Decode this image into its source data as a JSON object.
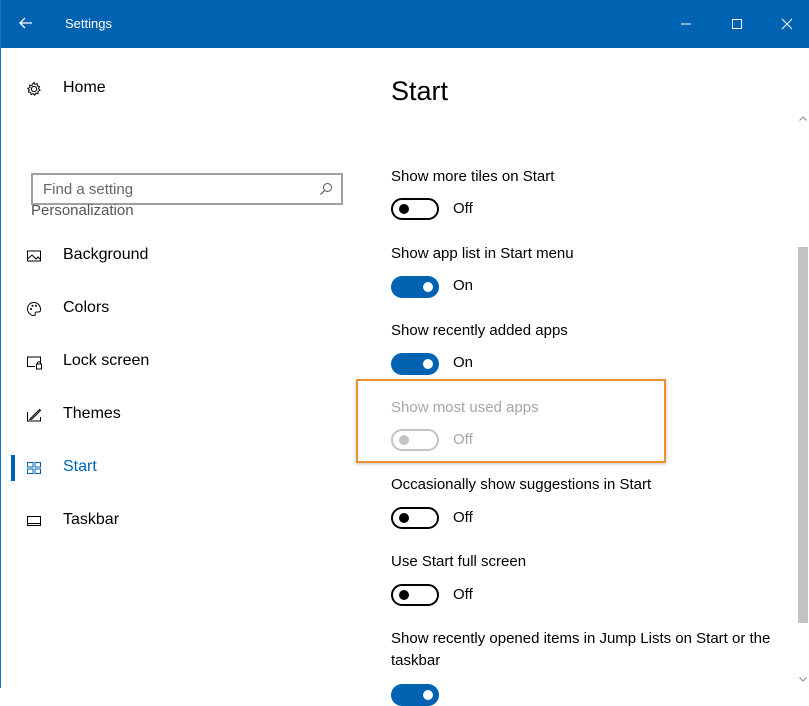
{
  "window": {
    "title": "Settings",
    "back_icon": "arrow-left-icon",
    "controls": [
      "minimize-icon",
      "maximize-icon",
      "close-icon"
    ],
    "accent": "#0063b1"
  },
  "sidebar": {
    "home_label": "Home",
    "search": {
      "placeholder": "Find a setting"
    },
    "section_label": "Personalization",
    "items": [
      {
        "label": "Background",
        "icon": "picture-icon"
      },
      {
        "label": "Colors",
        "icon": "palette-icon"
      },
      {
        "label": "Lock screen",
        "icon": "lock-screen-icon"
      },
      {
        "label": "Themes",
        "icon": "themes-icon"
      },
      {
        "label": "Start",
        "icon": "start-icon",
        "active": true
      },
      {
        "label": "Taskbar",
        "icon": "taskbar-icon"
      }
    ]
  },
  "main": {
    "title": "Start",
    "settings": [
      {
        "label": "Show more tiles on Start",
        "state": "Off"
      },
      {
        "label": "Show app list in Start menu",
        "state": "On"
      },
      {
        "label": "Show recently added apps",
        "state": "On"
      },
      {
        "label": "Show most used apps",
        "state": "Off",
        "disabled": true,
        "highlighted": true,
        "highlight_color": "#f0922b"
      },
      {
        "label": "Occasionally show suggestions in Start",
        "state": "Off"
      },
      {
        "label": "Use Start full screen",
        "state": "Off"
      },
      {
        "label": "Show recently opened items in Jump Lists on Start or the taskbar",
        "state": "On"
      }
    ]
  }
}
